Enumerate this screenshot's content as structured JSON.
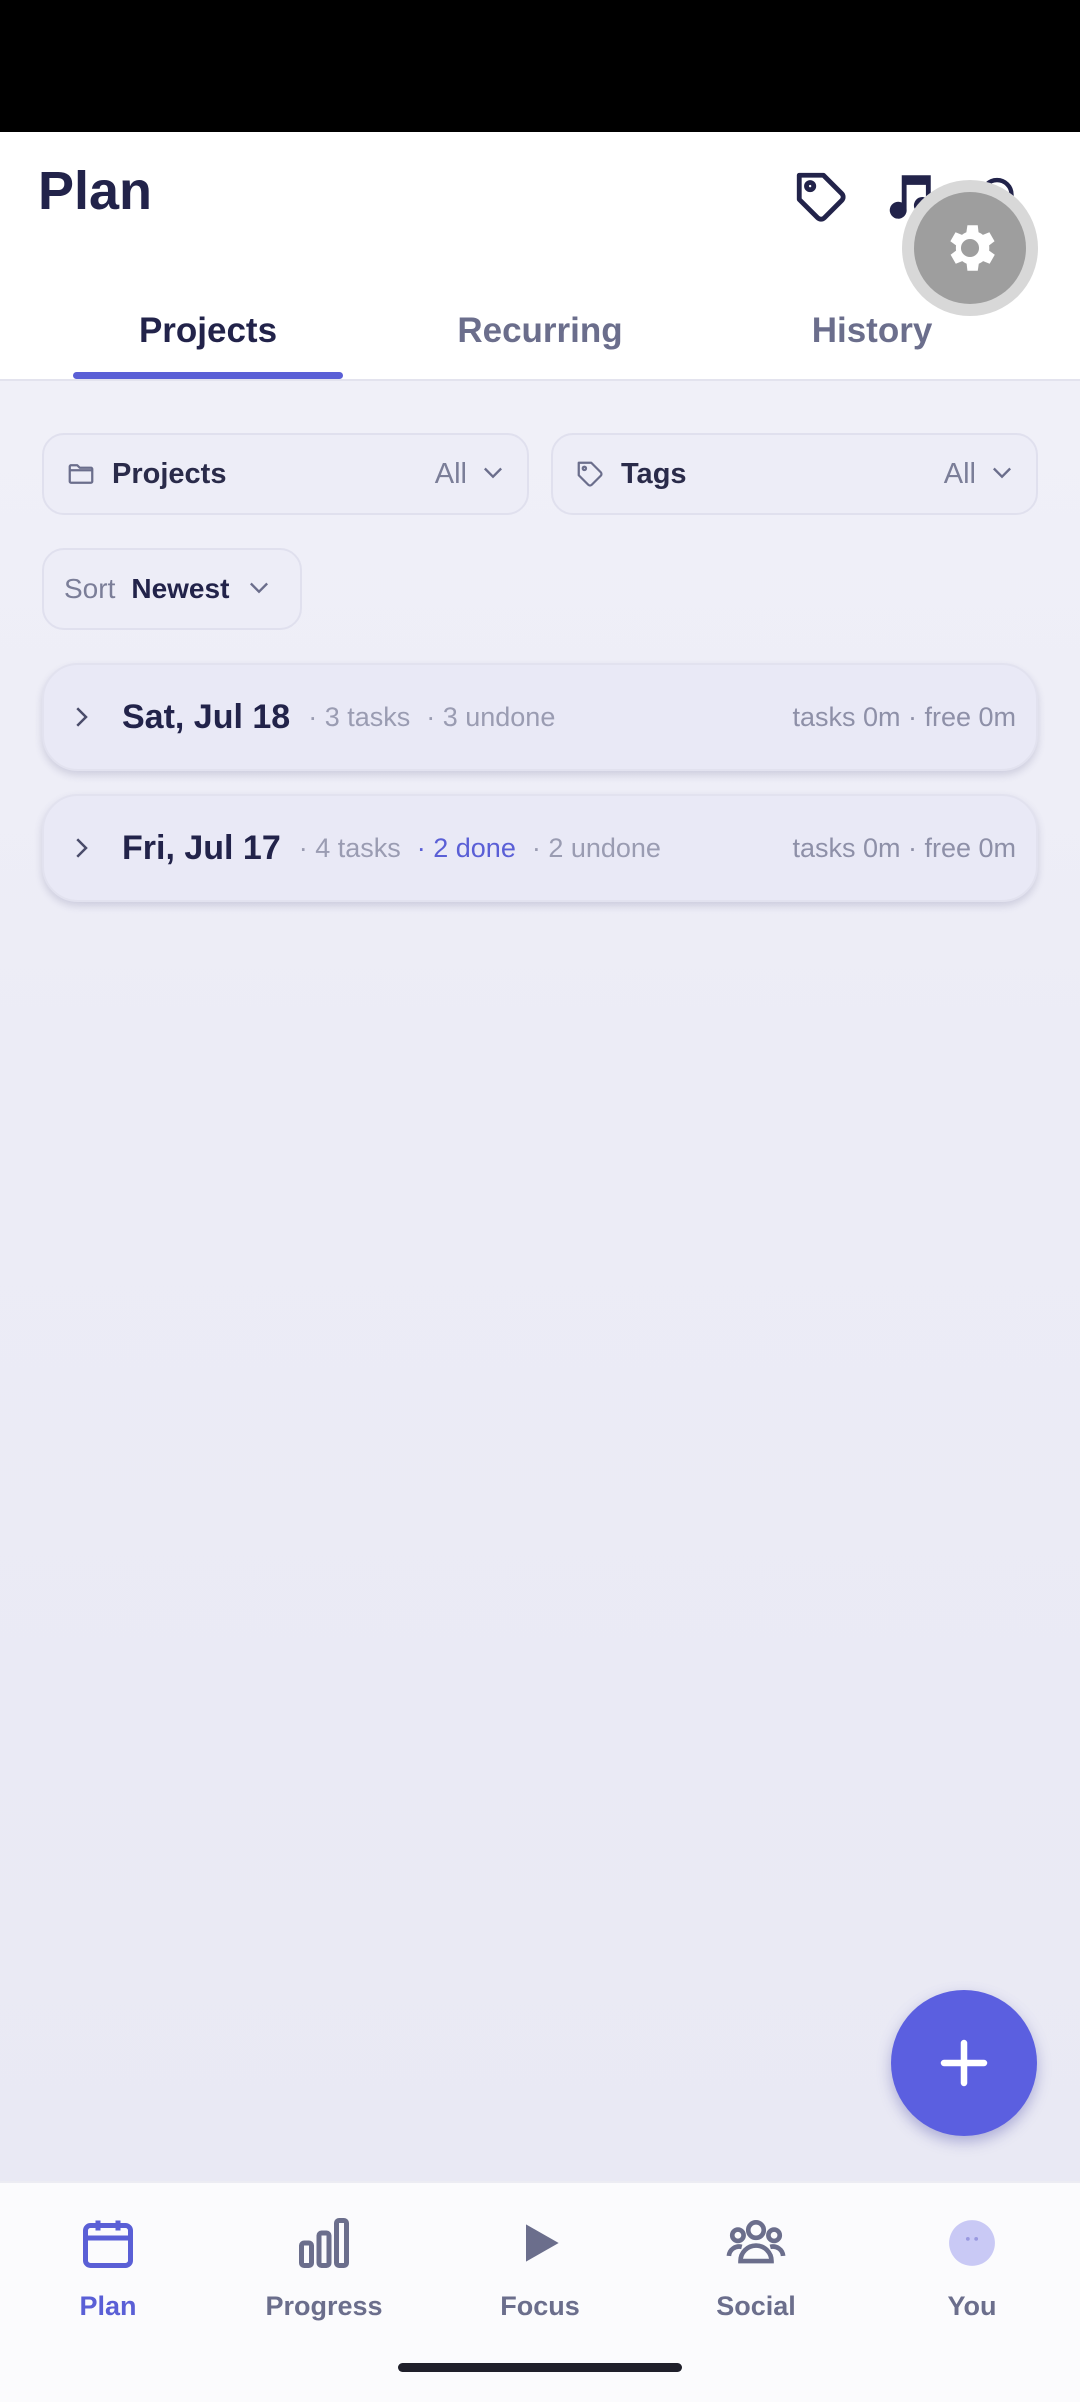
{
  "header": {
    "title": "Plan",
    "icons": [
      "tag-icon",
      "music-icon",
      "bell-icon",
      "gear-icon"
    ]
  },
  "tabs": [
    {
      "label": "Projects",
      "active": true
    },
    {
      "label": "Recurring",
      "active": false
    },
    {
      "label": "History",
      "active": false
    }
  ],
  "filters": {
    "projects": {
      "label": "Projects",
      "value": "All"
    },
    "tags": {
      "label": "Tags",
      "value": "All"
    },
    "sort": {
      "label": "Sort",
      "value": "Newest"
    }
  },
  "days": [
    {
      "date": "Sat, Jul 18",
      "tasks": "· 3 tasks",
      "done": "",
      "undone": "· 3 undone",
      "summary": "tasks 0m · free 0m"
    },
    {
      "date": "Fri, Jul 17",
      "tasks": "· 4 tasks",
      "done": "· 2 done",
      "undone": "· 2 undone",
      "summary": "tasks 0m · free 0m"
    }
  ],
  "nav": [
    {
      "label": "Plan",
      "icon": "calendar-icon",
      "active": true
    },
    {
      "label": "Progress",
      "icon": "bar-chart-icon",
      "active": false
    },
    {
      "label": "Focus",
      "icon": "play-icon",
      "active": false
    },
    {
      "label": "Social",
      "icon": "people-icon",
      "active": false
    },
    {
      "label": "You",
      "icon": "avatar-icon",
      "active": false
    }
  ],
  "colors": {
    "accent": "#5a5fd6",
    "fab": "#5b5fe0",
    "title": "#22234a",
    "muted": "#9a9cb2"
  }
}
